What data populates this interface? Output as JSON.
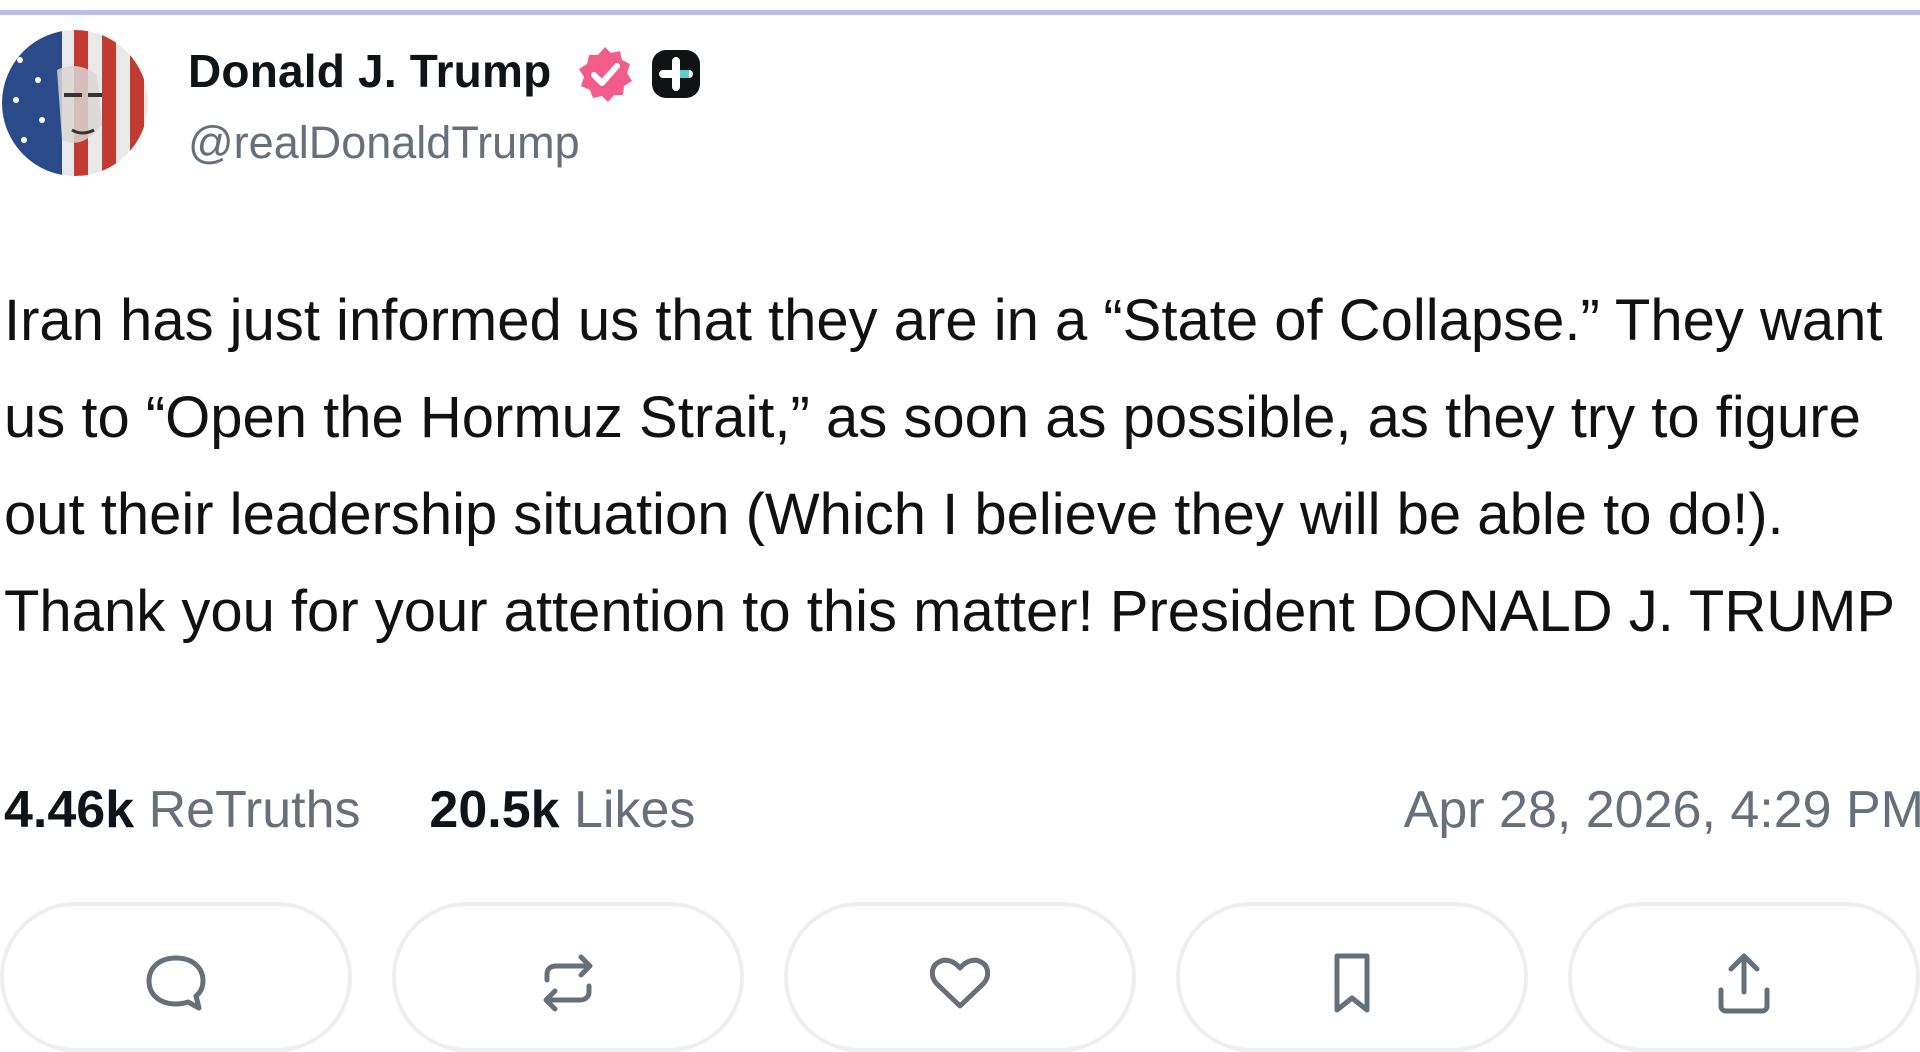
{
  "post": {
    "author": {
      "display_name": "Donald J. Trump",
      "handle": "@realDonaldTrump",
      "verified_icon": "verified-badge-icon",
      "extra_badge_icon": "plus-badge-icon"
    },
    "text": "Iran has just informed us that they are in a “State of Collapse.” They want us to “Open the Hormuz Strait,” as soon as possible, as they try to figure out their leadership situation (Which I believe they will be able to do!). Thank you for your attention to this matter! President DONALD J. TRUMP",
    "stats": {
      "retruths_count": "4.46k",
      "retruths_label": "ReTruths",
      "likes_count": "20.5k",
      "likes_label": "Likes"
    },
    "timestamp": "Apr 28, 2026, 4:29 PM"
  },
  "actions": [
    {
      "icon": "comment-icon"
    },
    {
      "icon": "retruth-icon"
    },
    {
      "icon": "like-icon"
    },
    {
      "icon": "bookmark-icon"
    },
    {
      "icon": "share-icon"
    }
  ],
  "colors": {
    "verified": "#f25c8a",
    "muted_text": "#66707a",
    "border": "#eceef1",
    "top_rule": "#b9c0f0"
  }
}
